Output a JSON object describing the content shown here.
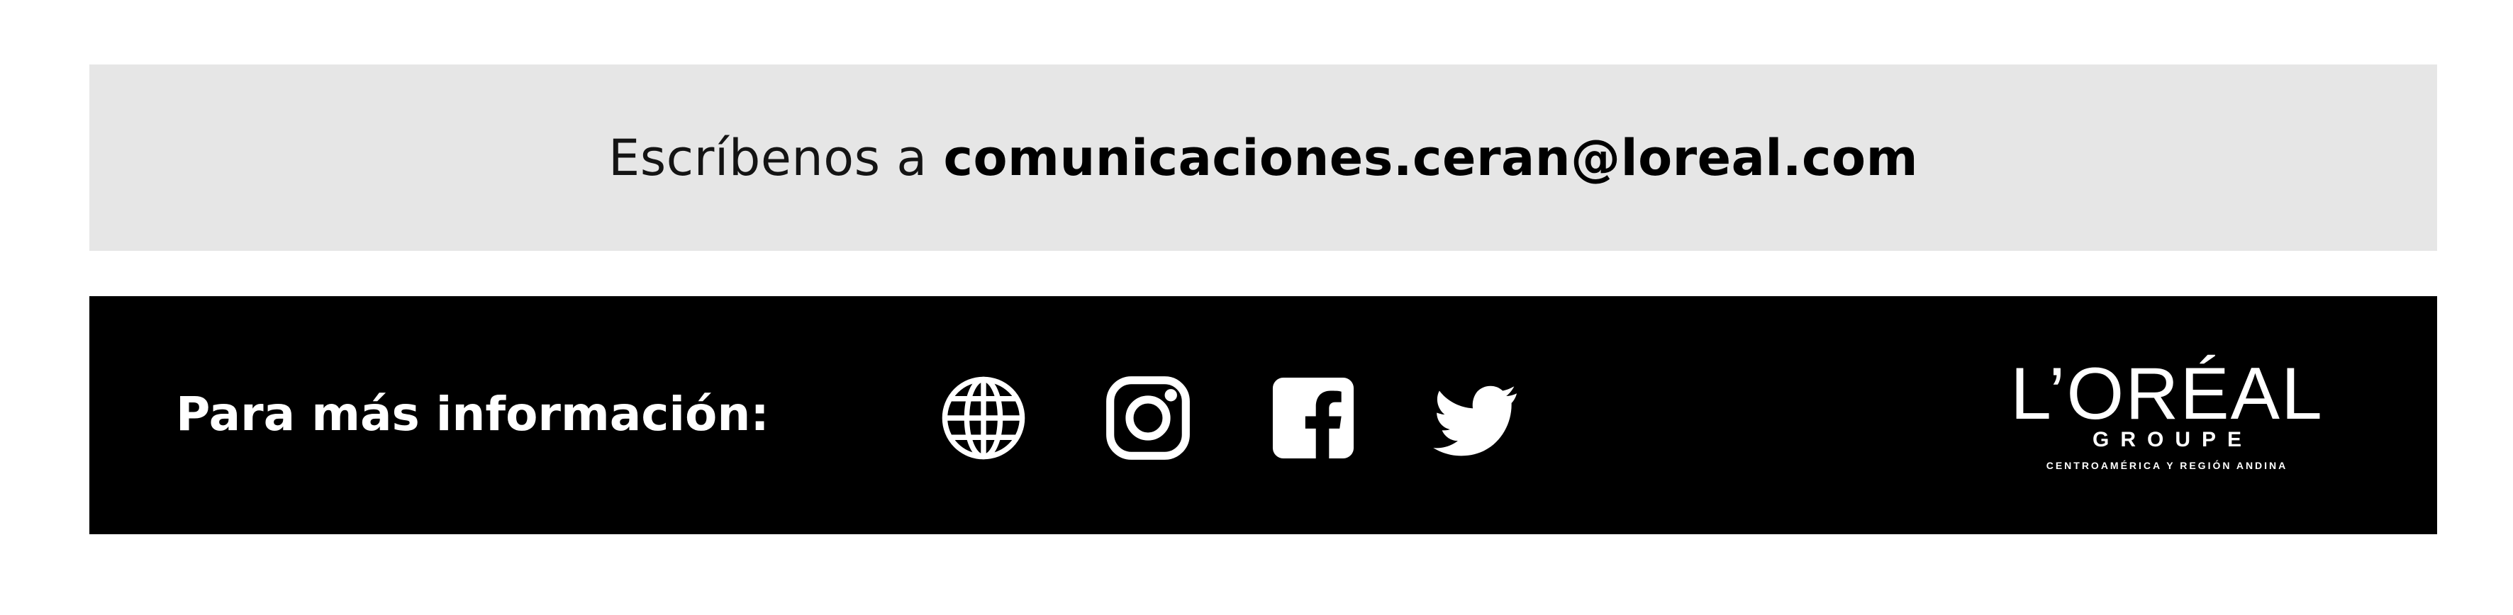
{
  "contact": {
    "lead": "Escríbenos a ",
    "email": "comunicaciones.ceran@loreal.com"
  },
  "footer": {
    "more_info": "Para más información:",
    "social_icons": [
      "globe-icon",
      "instagram-icon",
      "facebook-icon",
      "twitter-icon"
    ],
    "logo": {
      "wordmark": "L’ORÉAL",
      "subtitle": "GROUPE",
      "region": "CENTROAMÉRICA Y REGIÓN ANDINA"
    }
  },
  "colors": {
    "contact_background": "#e6e6e6",
    "footer_background": "#000000",
    "footer_foreground": "#ffffff",
    "text": "#141414"
  }
}
